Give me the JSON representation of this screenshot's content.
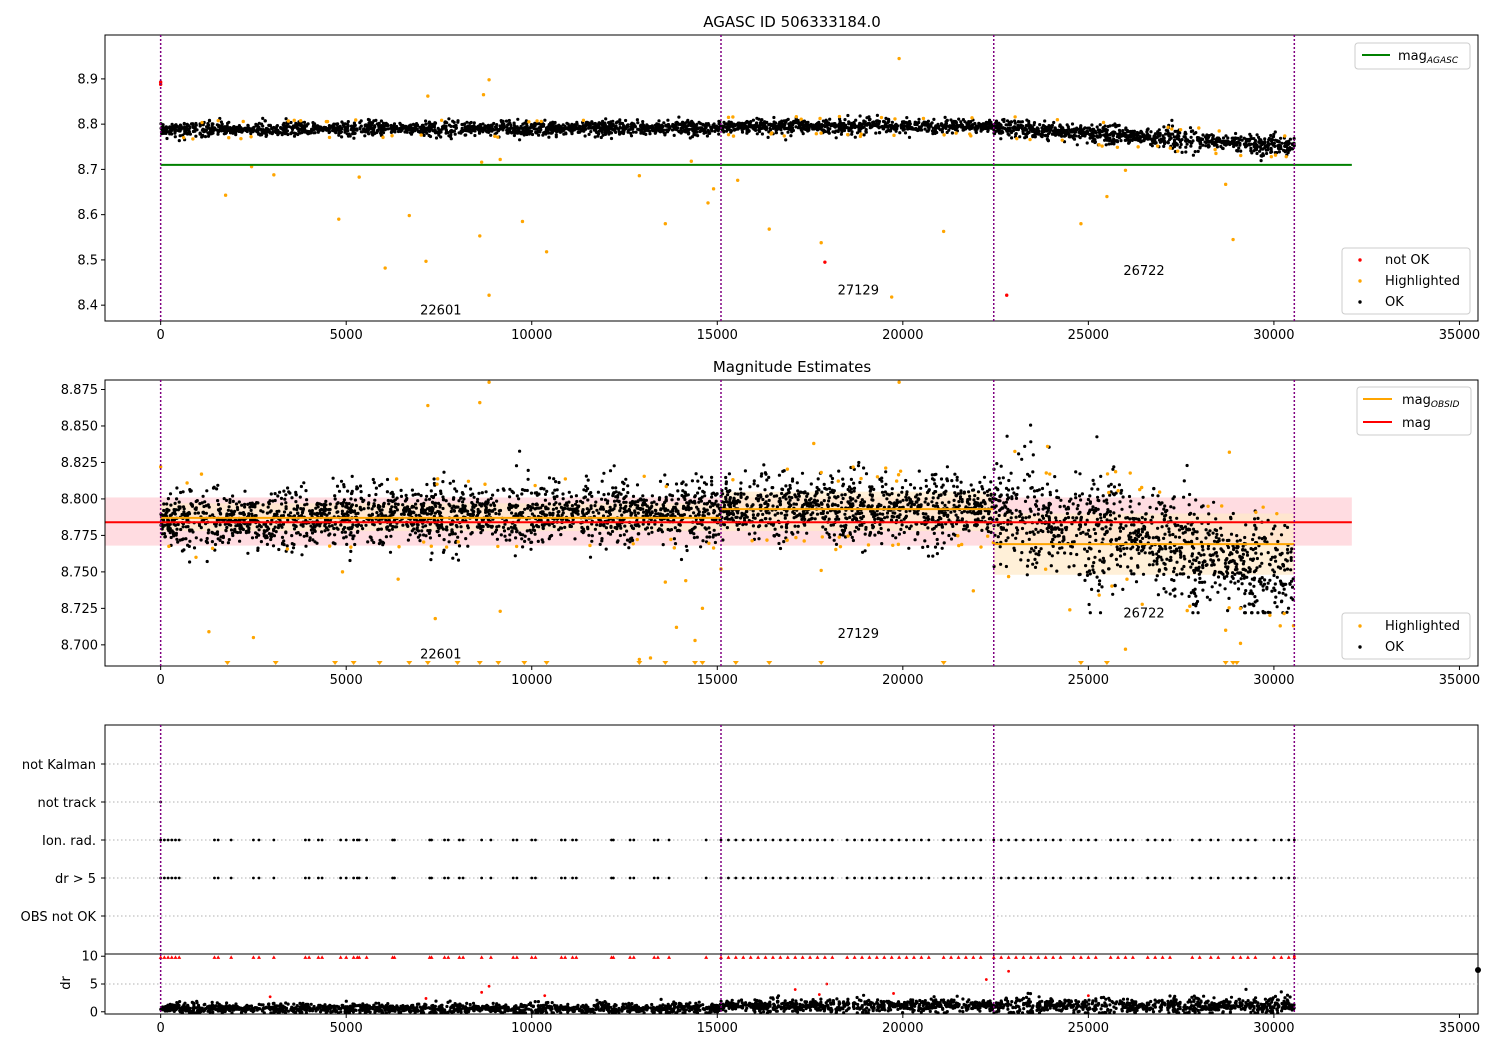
{
  "colors": {
    "ok": "#000000",
    "highlighted": "#ffa500",
    "not_ok": "#ff0000",
    "agasc_line": "#008000",
    "mag_line": "#ff0000",
    "obsid_line": "#ffa500",
    "obsid_sep": "#800080",
    "band_mag": "#ffd6dc",
    "band_obsid": "#ffe9c7",
    "grid": "#b0b0b0"
  },
  "chart_data": [
    {
      "type": "scatter",
      "title": "AGASC ID 506333184.0",
      "xlim": [
        -1500,
        35500
      ],
      "ylim": [
        8.365,
        8.997
      ],
      "xticks": [
        "0",
        "5000",
        "10000",
        "15000",
        "20000",
        "25000",
        "30000",
        "35000"
      ],
      "yticks": [
        "8.4",
        "8.5",
        "8.6",
        "8.7",
        "8.8",
        "8.9"
      ],
      "obsid_boundaries": [
        0,
        15100,
        22450,
        30550
      ],
      "obsid_labels": [
        {
          "text": "22601",
          "x": 7550,
          "y": 8.39
        },
        {
          "text": "27129",
          "x": 18800,
          "y": 8.435
        },
        {
          "text": "26722",
          "x": 26500,
          "y": 8.478
        }
      ],
      "mag_agasc": {
        "value": 8.71,
        "x_range": [
          0,
          32100
        ]
      },
      "ok_segments": [
        {
          "x": [
            0,
            15100
          ],
          "mean": [
            8.788,
            8.792
          ],
          "width": 0.015
        },
        {
          "x": [
            15100,
            22450
          ],
          "mean": [
            8.795,
            8.795
          ],
          "width": 0.016
        },
        {
          "x": [
            22450,
            30550
          ],
          "mean": [
            8.792,
            8.751
          ],
          "width": 0.02
        }
      ],
      "not_ok_points": [
        {
          "x": 0,
          "y": 8.893
        },
        {
          "x": 0,
          "y": 8.888
        },
        {
          "x": 17900,
          "y": 8.495
        },
        {
          "x": 22800,
          "y": 8.422
        }
      ],
      "highlighted_points": [
        {
          "x": 1750,
          "y": 8.643
        },
        {
          "x": 3050,
          "y": 8.688
        },
        {
          "x": 4800,
          "y": 8.59
        },
        {
          "x": 5350,
          "y": 8.683
        },
        {
          "x": 6050,
          "y": 8.482
        },
        {
          "x": 6700,
          "y": 8.598
        },
        {
          "x": 7200,
          "y": 8.862
        },
        {
          "x": 7150,
          "y": 8.497
        },
        {
          "x": 8600,
          "y": 8.553
        },
        {
          "x": 8700,
          "y": 8.865
        },
        {
          "x": 8850,
          "y": 8.898
        },
        {
          "x": 8850,
          "y": 8.422
        },
        {
          "x": 9750,
          "y": 8.585
        },
        {
          "x": 10400,
          "y": 8.518
        },
        {
          "x": 12900,
          "y": 8.686
        },
        {
          "x": 13600,
          "y": 8.58
        },
        {
          "x": 14300,
          "y": 8.718
        },
        {
          "x": 14750,
          "y": 8.626
        },
        {
          "x": 14900,
          "y": 8.657
        },
        {
          "x": 15550,
          "y": 8.676
        },
        {
          "x": 16400,
          "y": 8.568
        },
        {
          "x": 17800,
          "y": 8.538
        },
        {
          "x": 19700,
          "y": 8.418
        },
        {
          "x": 19900,
          "y": 8.945
        },
        {
          "x": 21100,
          "y": 8.563
        },
        {
          "x": 24800,
          "y": 8.58
        },
        {
          "x": 25500,
          "y": 8.64
        },
        {
          "x": 26000,
          "y": 8.698
        },
        {
          "x": 28900,
          "y": 8.545
        },
        {
          "x": 28700,
          "y": 8.667
        },
        {
          "x": 2450,
          "y": 8.706
        },
        {
          "x": 9150,
          "y": 8.722
        },
        {
          "x": 8650,
          "y": 8.716
        }
      ],
      "legends": [
        {
          "place": "upper-right",
          "entries": [
            "mag_AGASC"
          ]
        },
        {
          "place": "lower-right",
          "entries": [
            "not OK",
            "Highlighted",
            "OK"
          ]
        }
      ]
    },
    {
      "type": "scatter",
      "title": "Magnitude Estimates",
      "xlim": [
        -1500,
        35500
      ],
      "ylim": [
        8.6855,
        8.8815
      ],
      "xticks": [
        "0",
        "5000",
        "10000",
        "15000",
        "20000",
        "25000",
        "30000",
        "35000"
      ],
      "yticks": [
        "8.700",
        "8.725",
        "8.750",
        "8.775",
        "8.800",
        "8.825",
        "8.850",
        "8.875"
      ],
      "obsid_boundaries": [
        0,
        15100,
        22450,
        30550
      ],
      "obsid_labels": [
        {
          "text": "22601",
          "x": 7550,
          "y": 8.694
        },
        {
          "text": "27129",
          "x": 18800,
          "y": 8.708
        },
        {
          "text": "26722",
          "x": 26500,
          "y": 8.722
        }
      ],
      "mag": {
        "value": 8.784,
        "band": [
          8.768,
          8.801
        ],
        "x_range": [
          -1500,
          32100
        ]
      },
      "mag_obsid": [
        {
          "x": [
            0,
            15100
          ],
          "value": 8.787,
          "band": [
            8.778,
            8.797
          ]
        },
        {
          "x": [
            15100,
            22450
          ],
          "value": 8.793,
          "band": [
            8.778,
            8.805
          ]
        },
        {
          "x": [
            22450,
            30550
          ],
          "value": 8.769,
          "band": [
            8.748,
            8.79
          ]
        }
      ],
      "ok_segments": [
        {
          "x": [
            0,
            15100
          ],
          "mean": [
            8.785,
            8.792
          ],
          "width": 0.02
        },
        {
          "x": [
            15100,
            22450
          ],
          "mean": [
            8.795,
            8.792
          ],
          "width": 0.022
        },
        {
          "x": [
            22450,
            30550
          ],
          "mean": [
            8.792,
            8.75
          ],
          "width": 0.035
        }
      ],
      "highlighted_points": [
        {
          "x": 0,
          "y": 8.822
        },
        {
          "x": 1100,
          "y": 8.817
        },
        {
          "x": 1300,
          "y": 8.709
        },
        {
          "x": 2500,
          "y": 8.705
        },
        {
          "x": 4900,
          "y": 8.75
        },
        {
          "x": 6400,
          "y": 8.745
        },
        {
          "x": 7200,
          "y": 8.864
        },
        {
          "x": 7400,
          "y": 8.718
        },
        {
          "x": 8600,
          "y": 8.866
        },
        {
          "x": 8850,
          "y": 8.88
        },
        {
          "x": 9150,
          "y": 8.723
        },
        {
          "x": 12900,
          "y": 8.69
        },
        {
          "x": 13200,
          "y": 8.691
        },
        {
          "x": 13600,
          "y": 8.743
        },
        {
          "x": 13900,
          "y": 8.712
        },
        {
          "x": 14150,
          "y": 8.744
        },
        {
          "x": 14400,
          "y": 8.703
        },
        {
          "x": 14600,
          "y": 8.725
        },
        {
          "x": 15100,
          "y": 8.752
        },
        {
          "x": 17800,
          "y": 8.751
        },
        {
          "x": 19900,
          "y": 8.88
        },
        {
          "x": 21900,
          "y": 8.737
        },
        {
          "x": 24500,
          "y": 8.724
        },
        {
          "x": 26000,
          "y": 8.697
        },
        {
          "x": 28800,
          "y": 8.832
        },
        {
          "x": 28700,
          "y": 8.71
        },
        {
          "x": 29100,
          "y": 8.701
        },
        {
          "x": 23900,
          "y": 8.836
        },
        {
          "x": 17600,
          "y": 8.838
        }
      ],
      "clipped_markers_x": [
        1800,
        3100,
        4700,
        5200,
        5900,
        6700,
        7200,
        8000,
        8600,
        9100,
        9800,
        10400,
        12900,
        13600,
        14400,
        14600,
        15500,
        16400,
        17800,
        21100,
        24800,
        25500,
        28700,
        28900,
        29000
      ],
      "legends": [
        {
          "place": "upper-right",
          "entries": [
            "mag_OBSID",
            "mag"
          ]
        },
        {
          "place": "lower-right",
          "entries": [
            "Highlighted",
            "OK"
          ]
        }
      ]
    },
    {
      "type": "scatter",
      "xlim": [
        -1500,
        35500
      ],
      "categories": [
        "not Kalman",
        "not track",
        "Ion. rad.",
        "dr > 5",
        "OBS not OK"
      ],
      "obsid_boundaries": [
        0,
        15100,
        22450,
        30550
      ],
      "flag_points": {
        "not track": [
          0
        ],
        "Ion. rad.": [
          0,
          100,
          200,
          300,
          400,
          500,
          1450,
          1550,
          1900,
          2500,
          2650,
          3050,
          3900,
          4000,
          4250,
          4350,
          4850,
          5000,
          5200,
          5300,
          5350,
          5550,
          6250,
          6300,
          7250,
          7300,
          7650,
          7750,
          8050,
          8150,
          8650,
          8900,
          9500,
          9600,
          10000,
          10100,
          10800,
          10900,
          11100,
          11200,
          12150,
          12200,
          12650,
          12750,
          13300,
          13400,
          13700,
          14700,
          15100,
          15300,
          15500,
          15700,
          15900,
          16100,
          16300,
          16500,
          16700,
          16900,
          17100,
          17300,
          17500,
          17700,
          17900,
          18100,
          18500,
          18700,
          18900,
          19100,
          19300,
          19500,
          19700,
          19900,
          20100,
          20300,
          20500,
          20700,
          21100,
          21300,
          21500,
          21700,
          21900,
          22100,
          22450,
          22650,
          22850,
          23050,
          23250,
          23450,
          23650,
          23850,
          24050,
          24250,
          24600,
          24800,
          25000,
          25200,
          25600,
          25800,
          26000,
          26200,
          26600,
          26800,
          27000,
          27200,
          27800,
          28000,
          28300,
          28500,
          28900,
          29100,
          29300,
          29500,
          30000,
          30200,
          30400,
          30550
        ],
        "dr > 5": [
          0,
          100,
          200,
          300,
          400,
          500,
          1450,
          1550,
          1900,
          2500,
          2650,
          3050,
          3900,
          4000,
          4250,
          4350,
          4850,
          5000,
          5200,
          5300,
          5350,
          5550,
          6250,
          6300,
          7250,
          7300,
          7650,
          7750,
          8050,
          8150,
          8650,
          8900,
          9500,
          9600,
          10000,
          10100,
          10800,
          10900,
          11100,
          11200,
          12150,
          12200,
          12650,
          12750,
          13300,
          13400,
          13700,
          14700,
          15100,
          15300,
          15500,
          15700,
          15900,
          16100,
          16300,
          16500,
          16700,
          16900,
          17100,
          17300,
          17500,
          17700,
          17900,
          18100,
          18500,
          18700,
          18900,
          19100,
          19300,
          19500,
          19700,
          19900,
          20100,
          20300,
          20500,
          20700,
          21100,
          21300,
          21500,
          21700,
          21900,
          22100,
          22450,
          22650,
          22850,
          23050,
          23250,
          23450,
          23650,
          23850,
          24050,
          24250,
          24600,
          24800,
          25000,
          25200,
          25600,
          25800,
          26000,
          26200,
          26600,
          26800,
          27000,
          27200,
          27800,
          28000,
          28300,
          28500,
          28900,
          29100,
          29300,
          29500,
          30000,
          30200,
          30400,
          30550
        ]
      }
    },
    {
      "type": "scatter",
      "ylabel": "dr",
      "xlim": [
        -1500,
        35500
      ],
      "ylim": [
        -0.4,
        10.4
      ],
      "xticks": [
        "0",
        "5000",
        "10000",
        "15000",
        "20000",
        "25000",
        "30000",
        "35000"
      ],
      "yticks": [
        "0",
        "5",
        "10"
      ],
      "obsid_boundaries": [
        0,
        15100,
        22450,
        30550
      ],
      "ok_segments": [
        {
          "x": [
            0,
            15100
          ],
          "mean": [
            0.6,
            0.6
          ],
          "width": 0.9
        },
        {
          "x": [
            15100,
            22450
          ],
          "mean": [
            1.1,
            1.1
          ],
          "width": 1.2
        },
        {
          "x": [
            22450,
            30550
          ],
          "mean": [
            1.0,
            1.2
          ],
          "width": 1.4
        }
      ],
      "red_points": [
        {
          "x": 8650,
          "y": 3.5
        },
        {
          "x": 8850,
          "y": 4.6
        },
        {
          "x": 10350,
          "y": 2.9
        },
        {
          "x": 17100,
          "y": 4.0
        },
        {
          "x": 17950,
          "y": 5.0
        },
        {
          "x": 19750,
          "y": 3.3
        },
        {
          "x": 22250,
          "y": 5.8
        },
        {
          "x": 22850,
          "y": 7.3
        },
        {
          "x": 2950,
          "y": 2.7
        },
        {
          "x": 7150,
          "y": 2.4
        },
        {
          "x": 17750,
          "y": 3.1
        },
        {
          "x": 25000,
          "y": 2.9
        },
        {
          "x": 30550,
          "y": 10.0
        }
      ]
    }
  ],
  "legend_labels": {
    "mag_agasc": "mag",
    "mag_agasc_sub": "AGASC",
    "mag_obsid": "mag",
    "mag_obsid_sub": "OBSID",
    "mag": "mag",
    "not_ok": "not OK",
    "highlighted": "Highlighted",
    "ok": "OK"
  }
}
